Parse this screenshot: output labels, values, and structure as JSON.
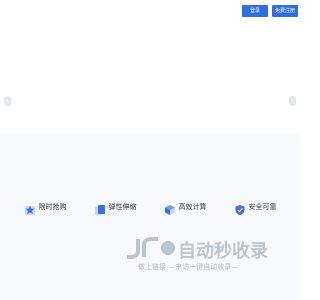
{
  "header": {
    "login_label": "登录",
    "register_label": "免费注册"
  },
  "carousel": {
    "prev_glyph": "‹",
    "next_glyph": "›"
  },
  "features": [
    {
      "label": "限时抢购",
      "icon": "star-badge-icon",
      "color": "#3b6fe0"
    },
    {
      "label": "弹性伸缩",
      "icon": "stack-icon",
      "color": "#3b6fe0"
    },
    {
      "label": "高效计算",
      "icon": "cube-icon",
      "color": "#3b6fe0"
    },
    {
      "label": "安全可靠",
      "icon": "shield-check-icon",
      "color": "#3b6fe0"
    }
  ],
  "watermark": {
    "title": "自动秒收录",
    "subtitle": "做上链接 —来访一键自动收录—",
    "logo": "jr-logo-icon"
  },
  "colors": {
    "accent": "#2f6fe4",
    "section_bg": "#f7f9fc"
  }
}
